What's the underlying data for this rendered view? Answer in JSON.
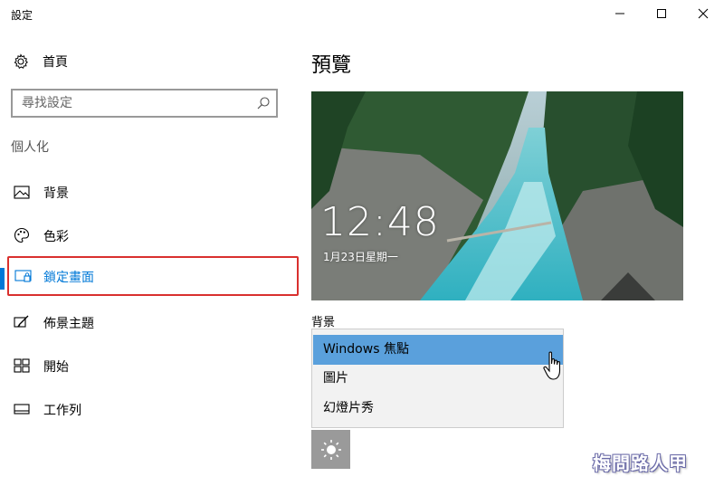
{
  "window": {
    "title": "設定",
    "controls": {
      "minimize": "minimize-icon",
      "maximize": "maximize-icon",
      "close": "close-icon"
    }
  },
  "sidebar": {
    "home_label": "首頁",
    "search": {
      "placeholder": "尋找設定",
      "icon": "search-icon"
    },
    "section_title": "個人化",
    "items": [
      {
        "label": "背景",
        "icon": "picture-icon",
        "selected": false
      },
      {
        "label": "色彩",
        "icon": "palette-icon",
        "selected": false
      },
      {
        "label": "鎖定畫面",
        "icon": "lock-screen-icon",
        "selected": true
      },
      {
        "label": "佈景主題",
        "icon": "theme-brush-icon",
        "selected": false
      },
      {
        "label": "開始",
        "icon": "start-grid-icon",
        "selected": false
      },
      {
        "label": "工作列",
        "icon": "taskbar-icon",
        "selected": false
      }
    ],
    "accent_color": "#0078d7",
    "highlight_border_color": "#d9302e"
  },
  "main": {
    "title": "預覽",
    "preview": {
      "time": "12:48",
      "date": "1月23日星期一"
    },
    "background_label": "背景",
    "dropdown": {
      "options": [
        "Windows 焦點",
        "圖片",
        "幻燈片秀"
      ],
      "highlighted": "Windows 焦點",
      "highlight_color": "#5aa0dc"
    },
    "swatch_icon": "brightness-icon"
  },
  "watermark": "梅問路人甲"
}
